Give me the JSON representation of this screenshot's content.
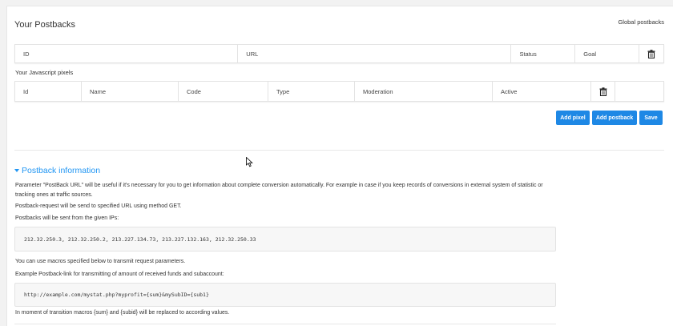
{
  "header": {
    "title": "Your Postbacks",
    "global_link": "Global postbacks"
  },
  "postbacks_table": {
    "columns": [
      "ID",
      "URL",
      "Status",
      "Goal"
    ],
    "delete_icon": "trash-icon"
  },
  "pixels": {
    "heading": "Your Javascript pixels",
    "columns": [
      "Id",
      "Name",
      "Code",
      "Type",
      "Moderation",
      "Active"
    ],
    "delete_icon": "trash-icon"
  },
  "actions": {
    "add_pixel": "Add pixel",
    "add_postback": "Add postback",
    "save": "Save"
  },
  "accent_color": "#1e88e5",
  "info": {
    "heading": "Postback information",
    "para1_line1": "Parameter \"PostBack URL\" will be useful if it's necessary for you to get information about complete conversion automatically. For example in case if you keep records of conversions in external system of statistic or",
    "para1_line2": "tracking ones at traffic sources.",
    "para2": "Postback-request will be send to specified URL using method GET.",
    "para3": "Postbacks will be sent from the given IPs:",
    "ips": "212.32.250.3, 212.32.250.2, 213.227.134.73, 213.227.132.163, 212.32.250.33",
    "para4": "You can use macros specified below to transmit request parameters.",
    "para5": "Example Postback-link for transmitting of amount of received funds and subaccount:",
    "example": "http://example.com/mystat.php?myprofit={sum}&mySubID={sub1}",
    "para6": "In moment of transition macros {sum} and {subid} will be replaced to according values."
  }
}
